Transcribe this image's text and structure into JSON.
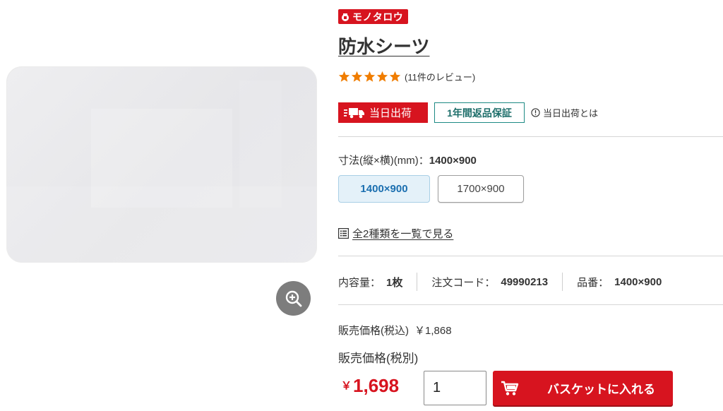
{
  "brand": {
    "logo_text": "モノタロウ",
    "color": "#d7141f"
  },
  "product": {
    "title": "防水シーツ",
    "rating": {
      "stars": 5,
      "max": 5,
      "review_text": "(11件のレビュー)",
      "star_color": "#f07d00"
    }
  },
  "badges": {
    "same_day": "当日出荷",
    "return_guarantee": "1年間返品保証",
    "info_link": "当日出荷とは"
  },
  "size": {
    "label": "寸法(縦×横)(mm)：",
    "selected_value": "1400×900",
    "options": [
      {
        "label": "1400×900",
        "selected": true
      },
      {
        "label": "1700×900",
        "selected": false
      }
    ]
  },
  "list_all": {
    "label": "全2種類を一覧で見る"
  },
  "specs": [
    {
      "label": "内容量：",
      "value": "1枚"
    },
    {
      "label": "注文コード：",
      "value": "49990213"
    },
    {
      "label": "品番：",
      "value": "1400×900"
    }
  ],
  "pricing": {
    "tax_incl_label": "販売価格(税込)",
    "tax_incl_value": "￥1,868",
    "tax_excl_label": "販売価格(税別)",
    "currency": "￥",
    "amount": "1,698"
  },
  "cart": {
    "quantity": "1",
    "button_label": "バスケットに入れる"
  },
  "icons": {
    "zoom": "zoom-in-icon",
    "truck": "truck-icon",
    "info": "info-icon",
    "list": "list-icon",
    "cart": "cart-icon",
    "star": "star-icon"
  }
}
